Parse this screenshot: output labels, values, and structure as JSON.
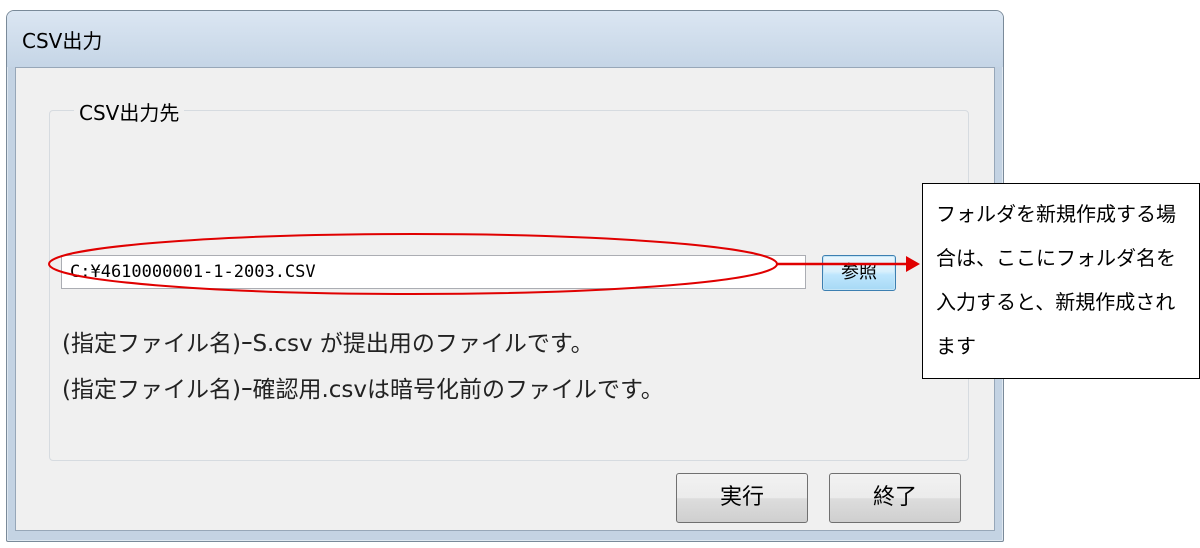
{
  "window": {
    "title": "CSV出力"
  },
  "group": {
    "legend": "CSV出力先"
  },
  "path_field": {
    "value": "C:¥4610000001-1-2003.CSV"
  },
  "browse_button": {
    "label": "参照"
  },
  "info": {
    "line1": "(指定ファイル名)ｰS.csv が提出用のファイルです。",
    "line2": "(指定ファイル名)ｰ確認用.csvは暗号化前のファイルです。"
  },
  "actions": {
    "run_label": "実行",
    "exit_label": "終了"
  },
  "annotation": {
    "text": "フォルダを新規作成する場合は、ここにフォルダ名を入力すると、新規作成されます",
    "color": "#e00000"
  }
}
